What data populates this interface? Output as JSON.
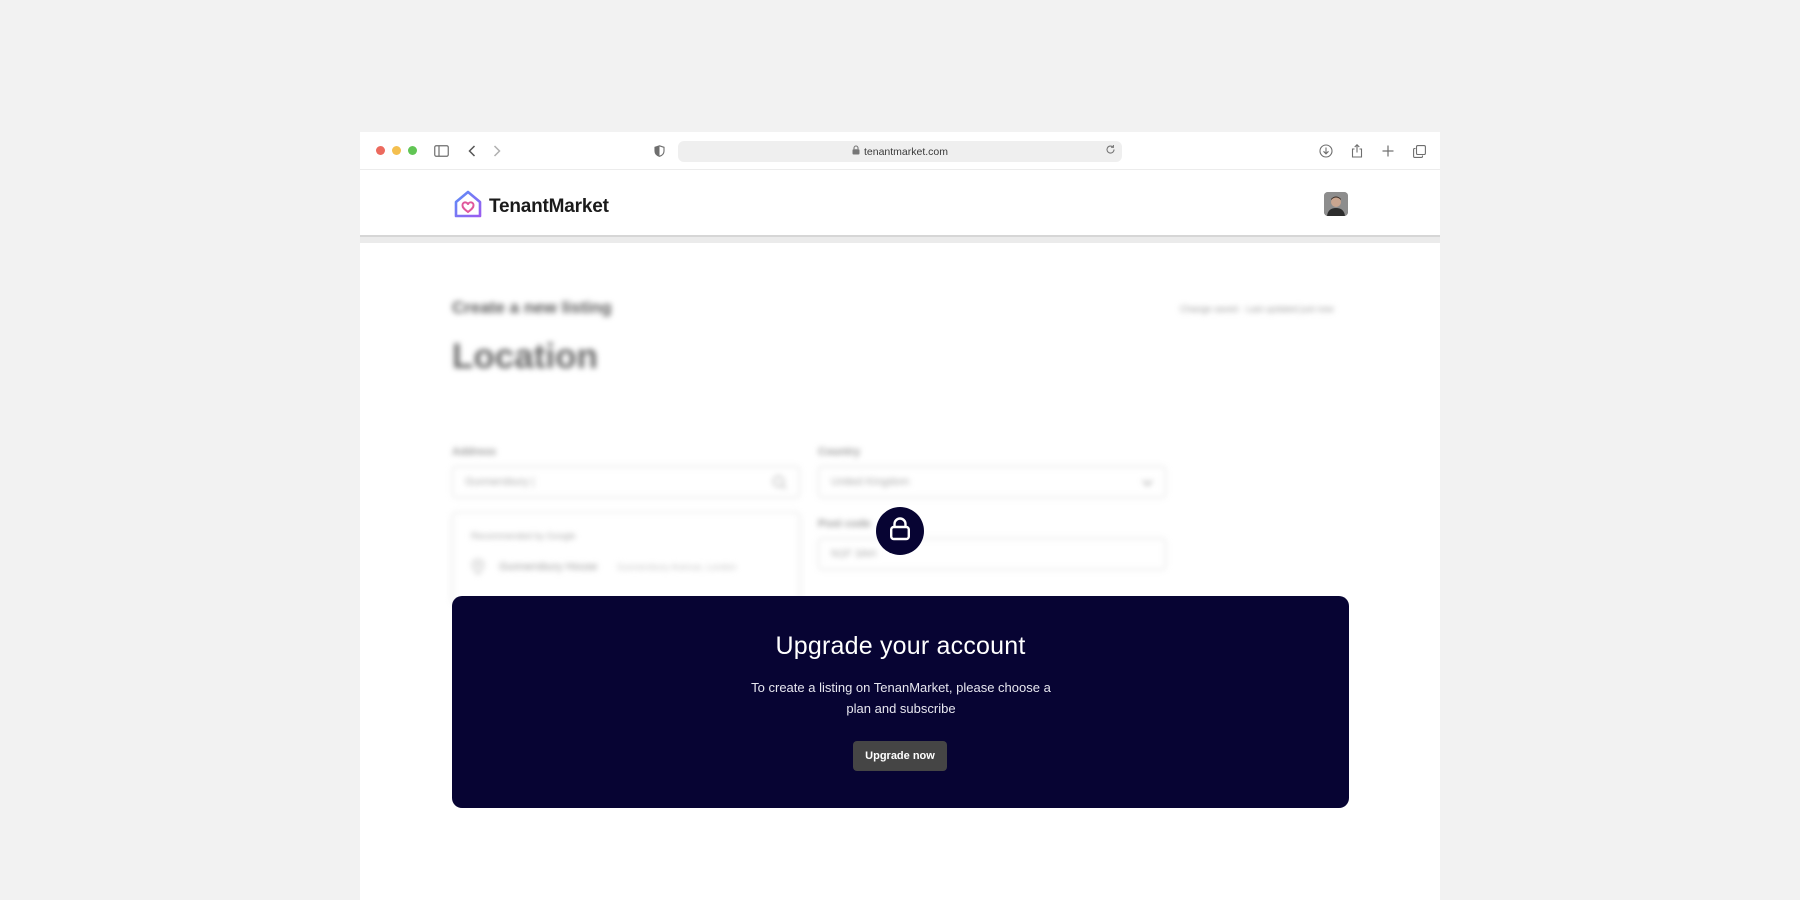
{
  "browser": {
    "url": "tenantmarket.com"
  },
  "header": {
    "brand": "TenantMarket",
    "brand_color": "#6b6cf6"
  },
  "listing": {
    "kicker": "Create a new listing",
    "title": "Location",
    "save_status": "Change saved · Last updated just now",
    "address_label": "Address",
    "address_value": "Gunnersbury |",
    "country_label": "Country",
    "country_value": "United Kingdom",
    "postcode_label": "Post code",
    "postcode_value": "N1F 3AH",
    "suggest_header": "Recommended by Google",
    "suggest_item": "Gunnersbury House",
    "suggest_detail": "Gunnersbury Avenue, London"
  },
  "upgrade": {
    "title": "Upgrade your account",
    "description": "To create a listing on TenanMarket, please choose a plan and subscribe",
    "button": "Upgrade now",
    "card_color": "#070433"
  }
}
